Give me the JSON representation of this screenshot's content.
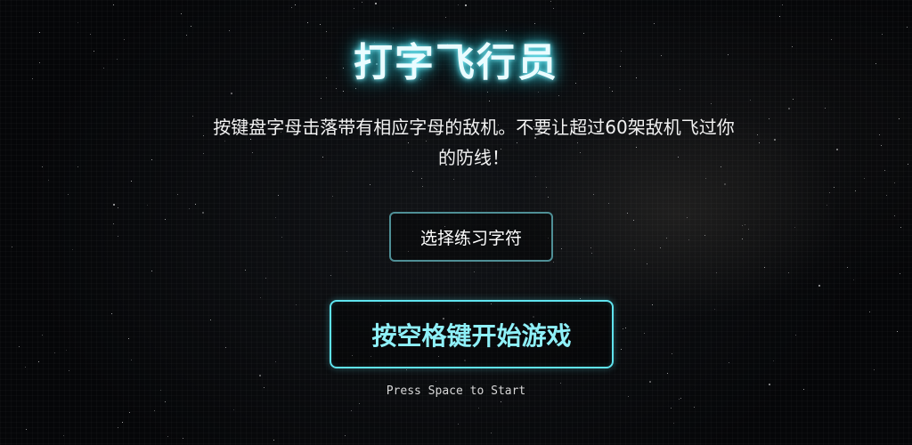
{
  "game": {
    "title": "打字飞行员",
    "description": "按键盘字母击落带有相应字母的敌机。不要让超过60架敌机飞过你的防线！",
    "char_select_label": "选择练习字符",
    "start_label": "按空格键开始游戏",
    "start_hint": "Press Space to Start"
  },
  "colors": {
    "background": "#050608",
    "title_glow": "#3fd6e6",
    "accent": "#5fe3ee",
    "secondary_border": "#4f8f96"
  }
}
